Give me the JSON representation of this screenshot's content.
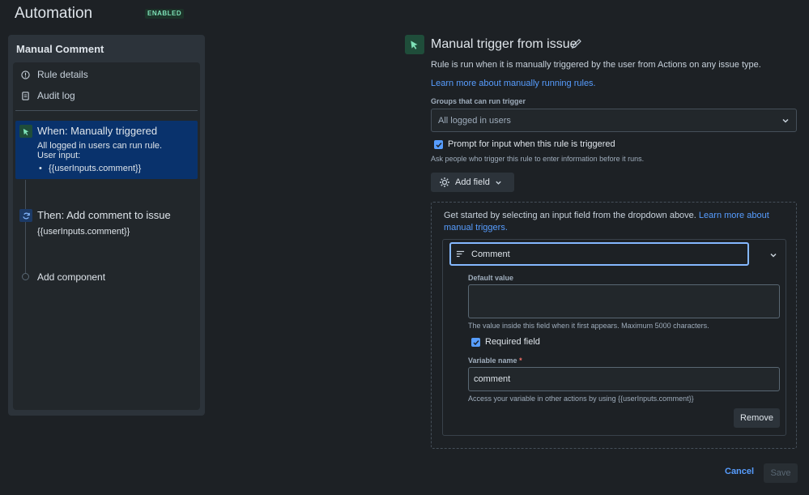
{
  "header": {
    "title": "Automation",
    "status_badge": "ENABLED"
  },
  "sidebar": {
    "rule_name": "Manual Comment",
    "nav": [
      {
        "label": "Rule details",
        "icon": "info-icon"
      },
      {
        "label": "Audit log",
        "icon": "document-icon"
      }
    ],
    "steps": [
      {
        "title": "When: Manually triggered",
        "line1": "All logged in users can run rule.",
        "line2": "User input:",
        "bullet": "{{userInputs.comment}}",
        "icon": "cursor-click-icon"
      },
      {
        "title": "Then: Add comment to issue",
        "detail": "{{userInputs.comment}}",
        "icon": "refresh-icon"
      }
    ],
    "add_component": "Add component"
  },
  "trigger": {
    "title": "Manual trigger from issue",
    "description": "Rule is run when it is manually triggered by the user from Actions on any issue type.",
    "learn_more": "Learn more about manually running rules.",
    "groups_label": "Groups that can run trigger",
    "groups_value": "All logged in users",
    "prompt_label": "Prompt for input when this rule is triggered",
    "prompt_help": "Ask people who trigger this rule to enter information before it runs.",
    "add_field": "Add field",
    "intro_text": "Get started by selecting an input field from the dropdown above.",
    "intro_link_1": "Learn more about",
    "intro_link_2": "manual triggers.",
    "field": {
      "type": "Comment",
      "default_label": "Default value",
      "default_value": "",
      "default_help": "The value inside this field when it first appears. Maximum 5000 characters.",
      "required_label": "Required field",
      "variable_label": "Variable name",
      "required_mark": "*",
      "variable_value": "comment",
      "variable_help": "Access your variable in other actions by using {{userInputs.comment}}",
      "remove": "Remove"
    }
  },
  "footer": {
    "cancel": "Cancel",
    "save": "Save"
  },
  "colors": {
    "accent": "#579dff",
    "success": "#7ee2b8",
    "selected": "#09326c"
  }
}
